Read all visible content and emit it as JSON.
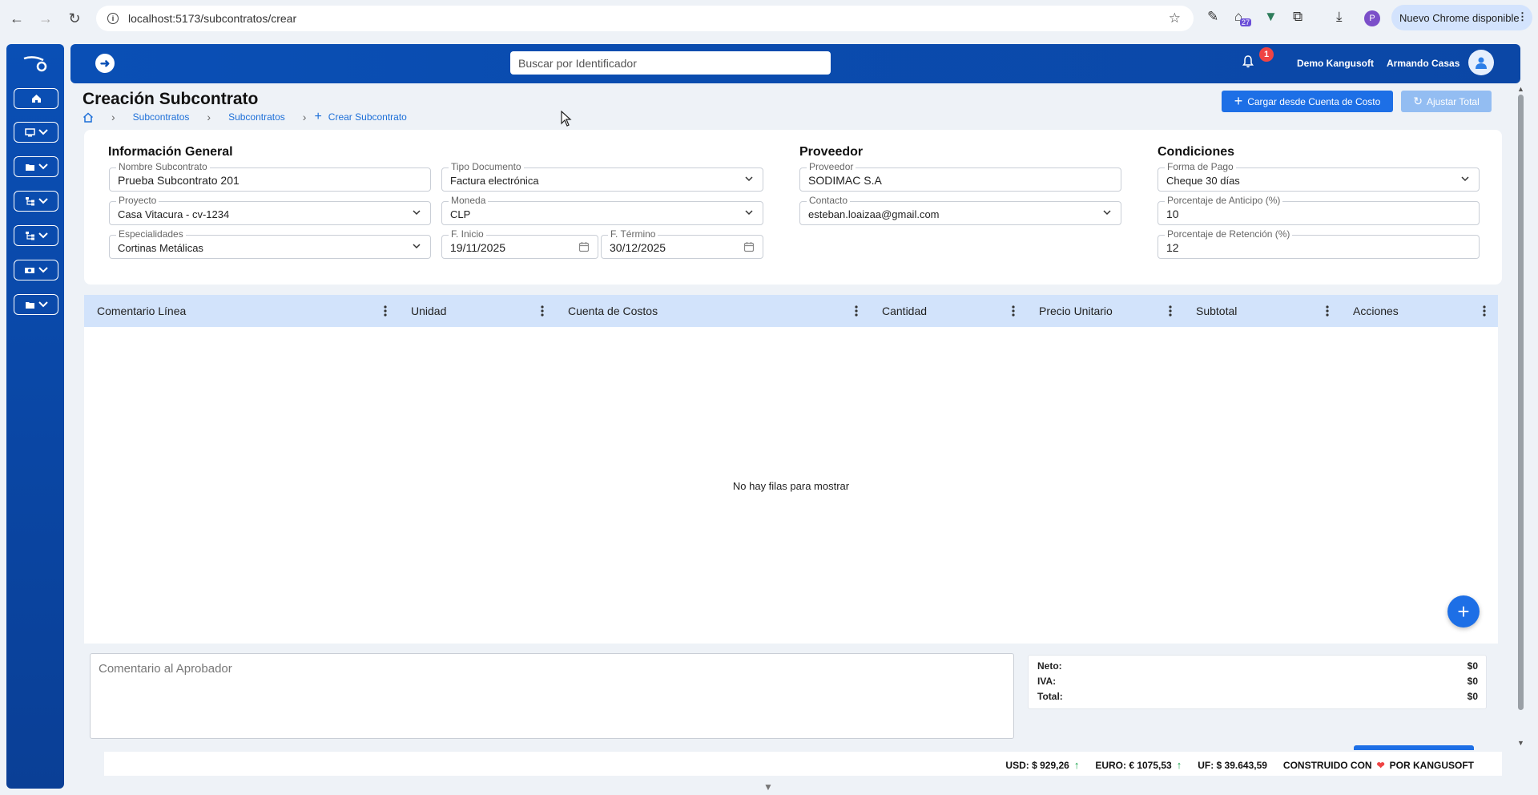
{
  "browser": {
    "url": "localhost:5173/subcontratos/crear",
    "update_label": "Nuevo Chrome disponible",
    "ext_badge": "27",
    "profile_initial": "P"
  },
  "header": {
    "search_placeholder": "Buscar por Identificador",
    "notification_count": "1",
    "company": "Demo Kangusoft",
    "user": "Armando Casas"
  },
  "page": {
    "title": "Creación Subcontrato",
    "breadcrumb": [
      "Subcontratos",
      "Subcontratos",
      "Crear Subcontrato"
    ],
    "btn_load": "Cargar desde Cuenta de Costo",
    "btn_adjust": "Ajustar Total"
  },
  "form": {
    "general_title": "Información General",
    "supplier_title": "Proveedor",
    "conditions_title": "Condiciones",
    "nombre": {
      "label": "Nombre Subcontrato",
      "value": "Prueba Subcontrato 201"
    },
    "tipo_doc": {
      "label": "Tipo Documento",
      "value": "Factura electrónica"
    },
    "proyecto": {
      "label": "Proyecto",
      "value": "Casa Vitacura - cv-1234"
    },
    "moneda": {
      "label": "Moneda",
      "value": "CLP"
    },
    "especialidades": {
      "label": "Especialidades",
      "value": "Cortinas Metálicas"
    },
    "f_inicio": {
      "label": "F. Inicio",
      "value": "19/11/2025"
    },
    "f_termino": {
      "label": "F. Término",
      "value": "30/12/2025"
    },
    "proveedor": {
      "label": "Proveedor",
      "value": "SODIMAC S.A"
    },
    "contacto": {
      "label": "Contacto",
      "value": "esteban.loaizaa@gmail.com"
    },
    "forma_pago": {
      "label": "Forma de Pago",
      "value": "Cheque 30 días"
    },
    "anticipo": {
      "label": "Porcentaje de Anticipo (%)",
      "value": "10"
    },
    "retencion": {
      "label": "Porcentaje de Retención (%)",
      "value": "12"
    }
  },
  "grid": {
    "columns": [
      "Comentario Línea",
      "Unidad",
      "Cuenta de Costos",
      "Cantidad",
      "Precio Unitario",
      "Subtotal",
      "Acciones"
    ],
    "empty_message": "No hay filas para mostrar"
  },
  "bottom": {
    "comment_placeholder": "Comentario al Aprobador",
    "neto_label": "Neto:",
    "neto_value": "$0",
    "iva_label": "IVA:",
    "iva_value": "$0",
    "total_label": "Total:",
    "total_value": "$0"
  },
  "footer": {
    "usd": "USD: $ 929,26",
    "euro": "EURO: € 1075,53",
    "uf": "UF: $ 39.643,59",
    "built_pre": "CONSTRUIDO CON",
    "built_post": "POR KANGUSOFT"
  },
  "colors": {
    "primary": "#1d6fe6",
    "sidebar": "#0a4fb5",
    "grid_header": "#d2e3fb"
  }
}
